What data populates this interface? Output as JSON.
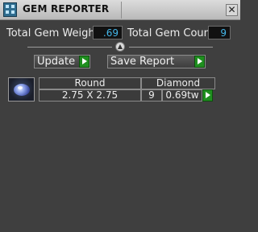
{
  "window": {
    "title": "GEM REPORTER"
  },
  "summary": {
    "total_weight_label": "Total Gem Weight",
    "total_weight_value": ".69",
    "total_count_label": "Total Gem Count",
    "total_count_value": "9"
  },
  "toolbar": {
    "update_label": "Update",
    "save_report_label": "Save Report"
  },
  "gems": [
    {
      "shape": "Round",
      "material": "Diamond",
      "size": "2.75 X 2.75",
      "count": "9",
      "weight": "0.69tw"
    }
  ],
  "colors": {
    "panel_bg": "#3f3f3f",
    "value_text": "#44b6e8",
    "play_green": "#1f8f1f"
  },
  "icons": {
    "app": "app-grid-icon",
    "close": "close-icon",
    "play": "play-arrow-icon",
    "gem": "gem-thumbnail"
  }
}
